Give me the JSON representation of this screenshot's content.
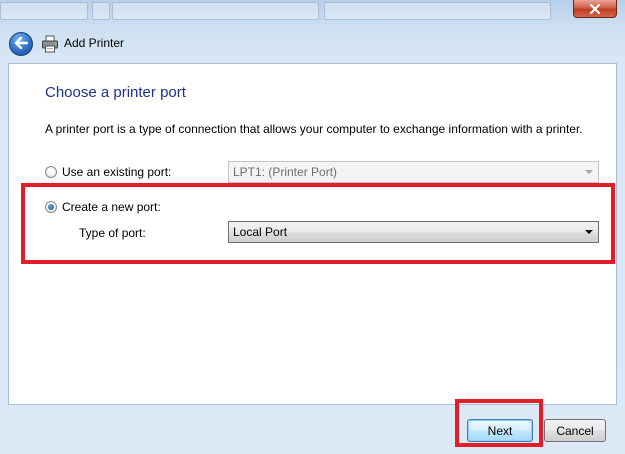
{
  "window": {
    "title": "Add Printer"
  },
  "page": {
    "heading": "Choose a printer port",
    "description": "A printer port is a type of connection that allows your computer to exchange information with a printer."
  },
  "options": {
    "existing_port": {
      "label": "Use an existing port:",
      "selected": false,
      "combo_value": "LPT1: (Printer Port)",
      "combo_enabled": false
    },
    "new_port": {
      "label": "Create a new port:",
      "selected": true,
      "type_label": "Type of port:",
      "combo_value": "Local Port",
      "combo_enabled": true
    }
  },
  "buttons": {
    "next": "Next",
    "cancel": "Cancel"
  },
  "icons": {
    "back": "back-arrow-icon",
    "printer": "printer-icon",
    "close": "close-icon"
  },
  "colors": {
    "heading": "#1e3287",
    "highlight": "#e21d2a",
    "content_bg": "#ffffff",
    "frame_bg": "#d9e7f5"
  }
}
